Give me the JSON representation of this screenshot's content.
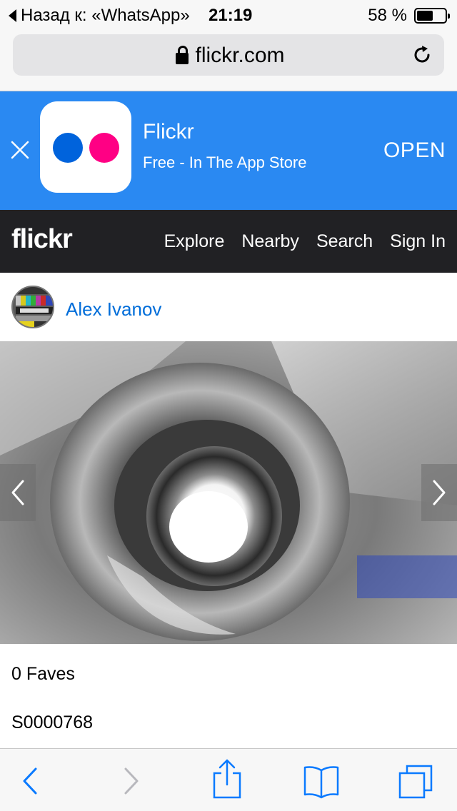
{
  "status_bar": {
    "back_label": "Назад к: «WhatsApp»",
    "time": "21:19",
    "battery_text": "58 %",
    "battery_level": 0.58
  },
  "url_bar": {
    "domain": "flickr.com"
  },
  "app_banner": {
    "app_name": "Flickr",
    "subtitle": "Free - In The App Store",
    "open_label": "OPEN",
    "dot_colors": [
      "#0063dc",
      "#ff0084"
    ],
    "background": "#2a89f2"
  },
  "nav": {
    "logo": "flickr",
    "links": [
      "Explore",
      "Nearby",
      "Search",
      "Sign In"
    ]
  },
  "owner": {
    "name": "Alex Ivanov"
  },
  "photo": {
    "faves": "0 Faves",
    "title": "S0000768"
  },
  "icons": {
    "banner_close": "close-icon",
    "lock": "lock-icon",
    "reload": "reload-icon",
    "prev_photo": "chevron-left-icon",
    "next_photo": "chevron-right-icon",
    "toolbar": [
      "back-icon",
      "forward-icon",
      "share-icon",
      "bookmarks-icon",
      "tabs-icon"
    ]
  }
}
